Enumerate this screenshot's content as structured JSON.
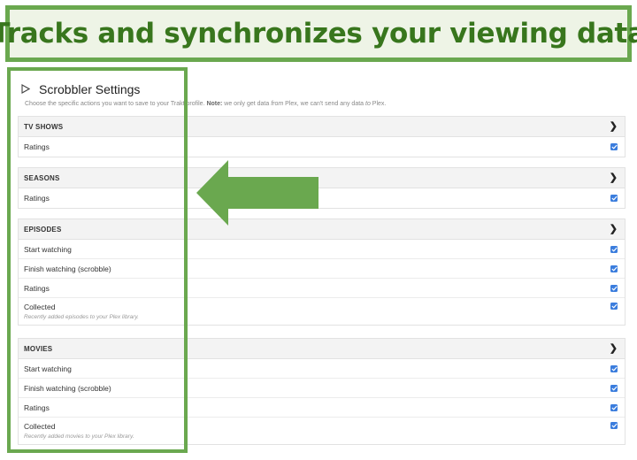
{
  "banner": {
    "text": "Tracks and synchronizes your viewing data"
  },
  "settings": {
    "title": "Scrobbler Settings",
    "description_lead": "Choose the specific actions you want to save to your Trakt profile.",
    "description_note_label": "Note:",
    "description_part1": " we only get data ",
    "description_from": "from",
    "description_part2": " Plex, we can't send any data ",
    "description_to": "to",
    "description_part3": " Plex."
  },
  "sections": {
    "tv_shows": {
      "name": "TV SHOWS",
      "rows": [
        {
          "label": "Ratings"
        }
      ]
    },
    "seasons": {
      "name": "SEASONS",
      "rows": [
        {
          "label": "Ratings"
        }
      ]
    },
    "episodes": {
      "name": "EPISODES",
      "rows": [
        {
          "label": "Start watching"
        },
        {
          "label": "Finish watching (scrobble)"
        },
        {
          "label": "Ratings"
        },
        {
          "label": "Collected",
          "sublabel": "Recently added episodes to your Plex library."
        }
      ]
    },
    "movies": {
      "name": "MOVIES",
      "rows": [
        {
          "label": "Start watching"
        },
        {
          "label": "Finish watching (scrobble)"
        },
        {
          "label": "Ratings"
        },
        {
          "label": "Collected",
          "sublabel": "Recently added movies to your Plex library."
        }
      ]
    }
  },
  "icons": {
    "section_toggle": "chevron-right-icon",
    "title_icon": "play-outline-icon",
    "checkbox": "checkmark-icon"
  },
  "colors": {
    "accent_green": "#6aa84f",
    "banner_text": "#38761d",
    "checkbox_blue": "#3b7ddd"
  }
}
